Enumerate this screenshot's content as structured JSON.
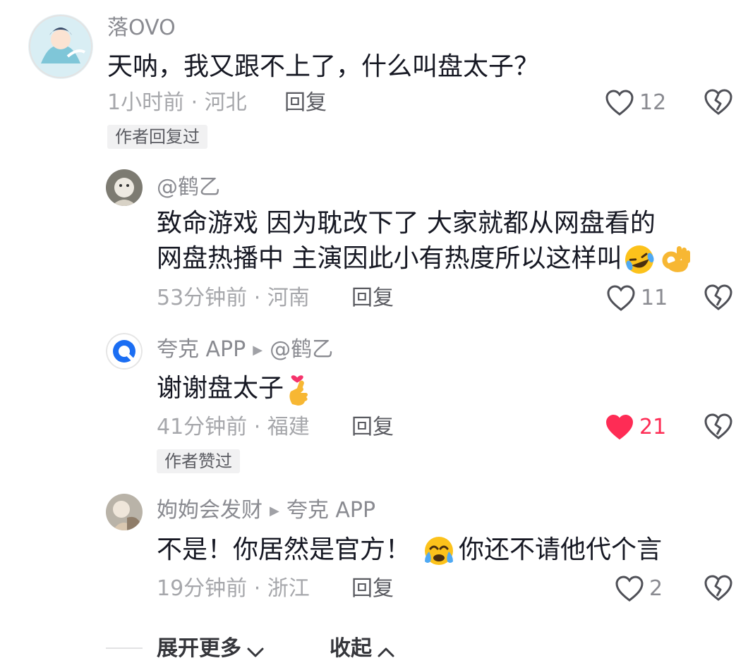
{
  "comments": [
    {
      "username": "落OVO",
      "text": "天呐，我又跟不上了，什么叫盘太子？",
      "time_location": "1小时前 · 河北",
      "reply_label": "回复",
      "likes": "12",
      "liked": false,
      "badge": "作者回复过"
    }
  ],
  "replies": [
    {
      "username": "@鹤乙",
      "text_line1": "致命游戏 因为耽改下了 大家就都从网盘看的",
      "text_line2": "网盘热播中 主演因此小有热度所以这样叫",
      "emojis": [
        "rofl-emoji",
        "ok-hand-emoji"
      ],
      "time_location": "53分钟前 · 河南",
      "reply_label": "回复",
      "likes": "11",
      "liked": false
    },
    {
      "username": "夸克 APP",
      "reply_to": "@鹤乙",
      "text": "谢谢盘太子",
      "emojis": [
        "finger-heart-emoji"
      ],
      "time_location": "41分钟前 · 福建",
      "reply_label": "回复",
      "likes": "21",
      "liked": true,
      "badge": "作者赞过"
    },
    {
      "username": "姁姁会发财",
      "reply_to": "夸克 APP",
      "text_before": "不是！你居然是官方！",
      "text_after": "你还不请他代个言",
      "emojis": [
        "crying-emoji"
      ],
      "time_location": "19分钟前 · 浙江",
      "reply_label": "回复",
      "likes": "2",
      "liked": false
    }
  ],
  "footer": {
    "expand_label": "展开更多",
    "collapse_label": "收起"
  },
  "colors": {
    "liked_heart": "#fe2c55",
    "meta_gray": "#a6a7ab",
    "quark_blue": "#1b6ef3"
  }
}
